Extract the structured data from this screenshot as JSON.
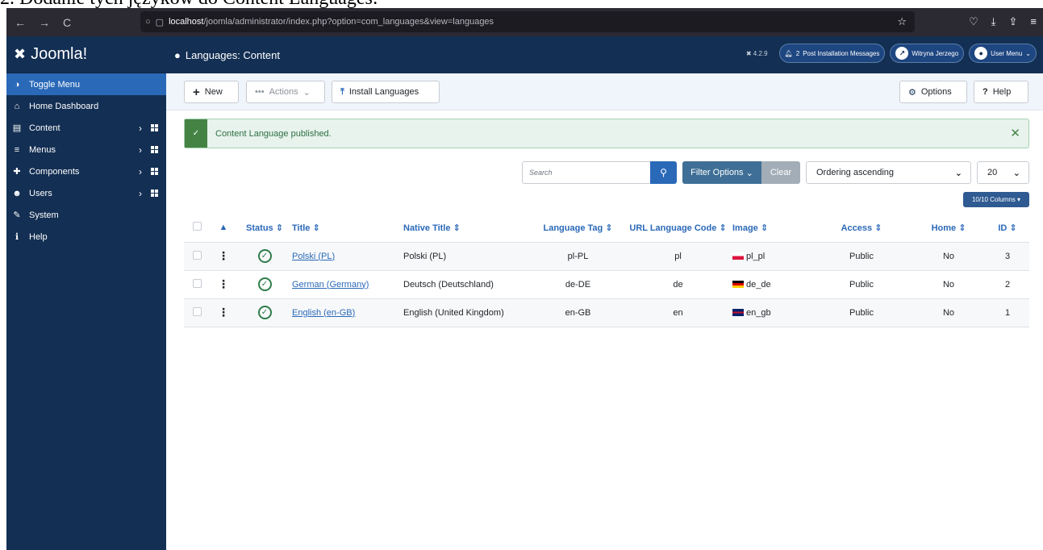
{
  "caption": "2. Dodanie tych językòw do Content Languages:",
  "browser": {
    "nav": [
      "←",
      "→",
      "C"
    ],
    "url_host": "localhost",
    "url_path": "/joomla/administrator/index.php?option=com_languages&view=languages",
    "icons_right": [
      "☆",
      "♡",
      "⤓",
      "⇪",
      "≡"
    ]
  },
  "sidebar": {
    "brand": "Joomla!",
    "items": [
      {
        "icon": "toggle-icon",
        "glyph": "◑",
        "label": "Toggle Menu",
        "active": true
      },
      {
        "icon": "home-icon",
        "glyph": "⌂",
        "label": "Home Dashboard"
      },
      {
        "icon": "file-icon",
        "glyph": "▤",
        "label": "Content",
        "expand": true
      },
      {
        "icon": "list-icon",
        "glyph": "≡",
        "label": "Menus",
        "expand": true
      },
      {
        "icon": "puzzle-icon",
        "glyph": "✚",
        "label": "Components",
        "expand": true
      },
      {
        "icon": "users-icon",
        "glyph": "☻",
        "label": "Users",
        "expand": true
      },
      {
        "icon": "wrench-icon",
        "glyph": "✎",
        "label": "System"
      },
      {
        "icon": "info-icon",
        "glyph": "ℹ",
        "label": "Help"
      }
    ]
  },
  "header": {
    "title": "Languages: Content",
    "version": "✖ 4.2.9",
    "messages_count": "2",
    "messages_label": "Post Installation Messages",
    "site_label": "Witryna Jerzego",
    "user_label": "User Menu"
  },
  "toolbar": {
    "new": "New",
    "actions": "Actions",
    "install": "Install Languages",
    "options": "Options",
    "help": "Help"
  },
  "alert": {
    "message": "Content Language published."
  },
  "filters": {
    "search_placeholder": "Search",
    "filter_options": "Filter Options",
    "clear": "Clear",
    "ordering": "Ordering ascending",
    "limit": "20",
    "columns": "10/10 Columns"
  },
  "table": {
    "headers": [
      "Status ⇕",
      "Title ⇕",
      "Native Title ⇕",
      "Language Tag ⇕",
      "URL Language Code ⇕",
      "Image ⇕",
      "Access ⇕",
      "Home ⇕",
      "ID ⇕"
    ],
    "rows": [
      {
        "title": "Polski (PL)",
        "native": "Polski (PL)",
        "tag": "pl-PL",
        "code": "pl",
        "image": "pl_pl",
        "access": "Public",
        "home": "No",
        "id": "3"
      },
      {
        "title": "German (Germany)",
        "native": "Deutsch (Deutschland)",
        "tag": "de-DE",
        "code": "de",
        "image": "de_de",
        "access": "Public",
        "home": "No",
        "id": "2"
      },
      {
        "title": "English (en-GB)",
        "native": "English (United Kingdom)",
        "tag": "en-GB",
        "code": "en",
        "image": "en_gb",
        "access": "Public",
        "home": "No",
        "id": "1"
      }
    ]
  },
  "colors": {
    "sidebar": "#132f53",
    "accent": "#2a69b8",
    "success": "#448344"
  }
}
